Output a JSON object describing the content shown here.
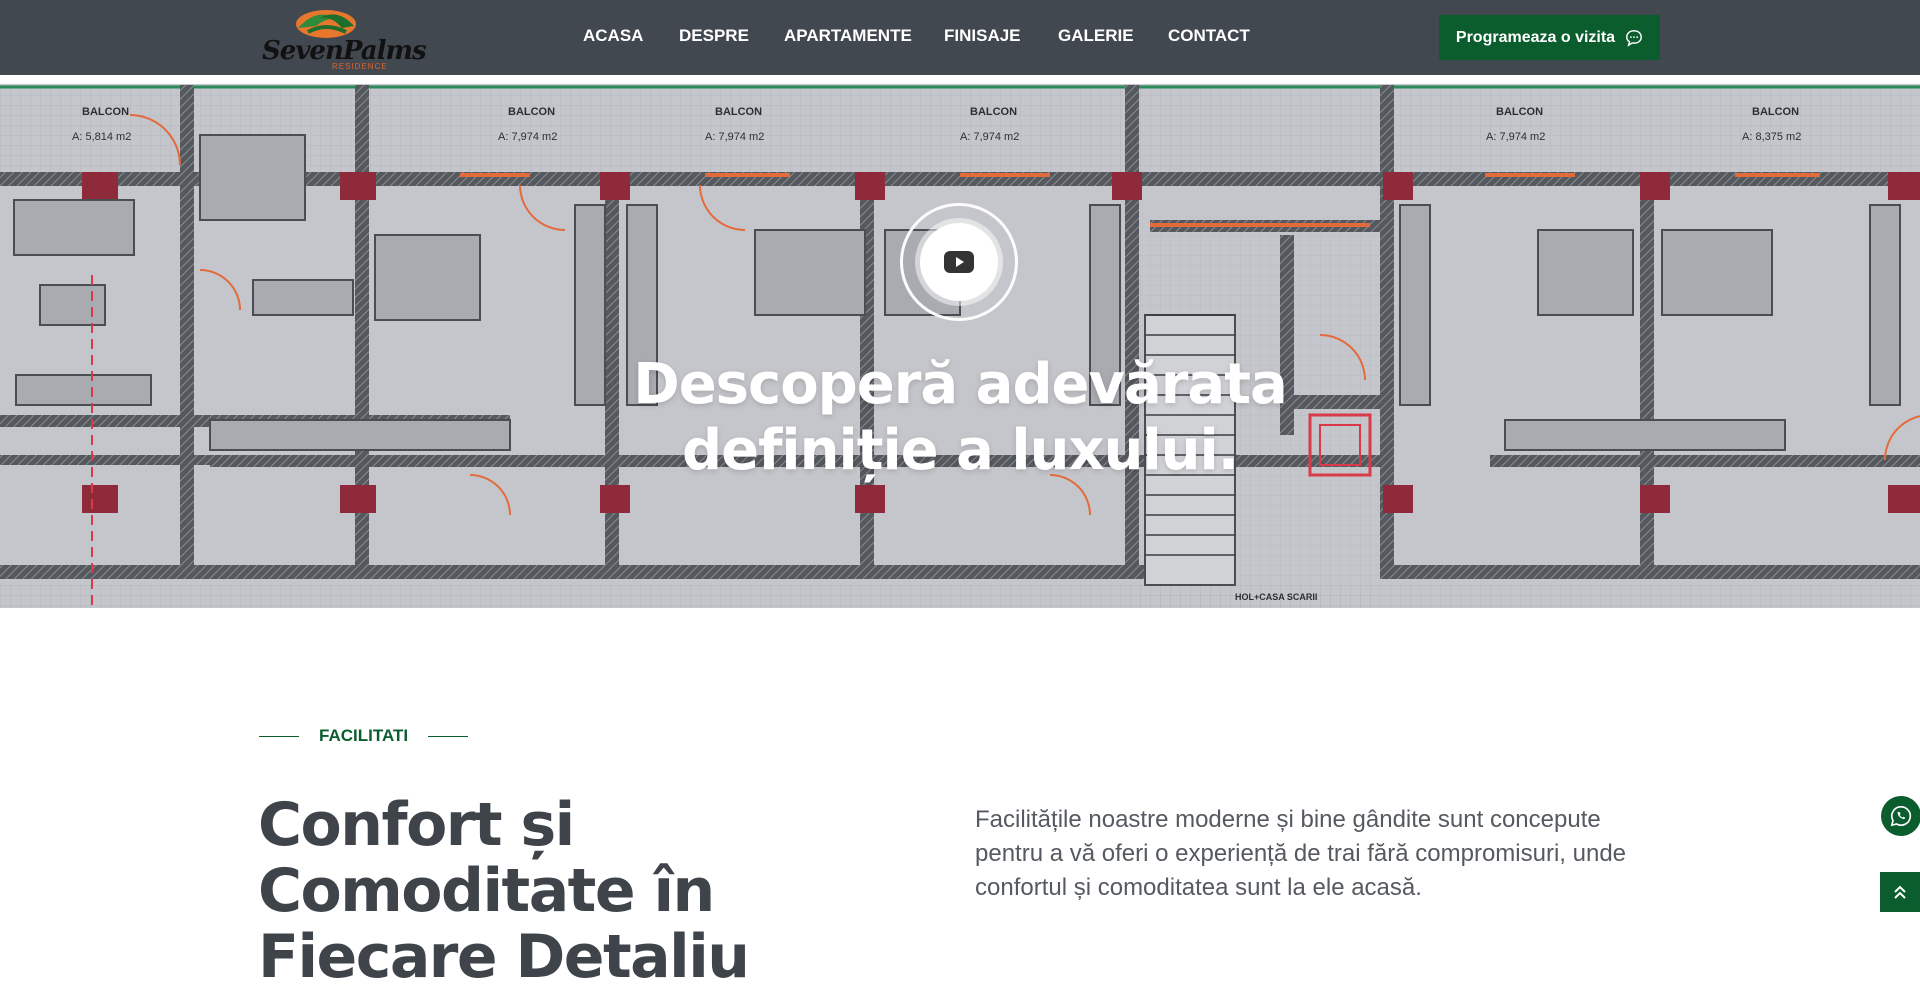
{
  "brand": {
    "name": "SevenPalms",
    "subtitle": "RESIDENCE"
  },
  "nav": [
    {
      "label": "ACASA"
    },
    {
      "label": "DESPRE"
    },
    {
      "label": "APARTAMENTE"
    },
    {
      "label": "FINISAJE"
    },
    {
      "label": "GALERIE"
    },
    {
      "label": "CONTACT"
    }
  ],
  "cta": {
    "label": "Programeaza o vizita",
    "icon": "chat-icon"
  },
  "hero": {
    "title": "Descoperă adevărata definiție a luxului.",
    "play_icon": "youtube-play-icon",
    "plan_labels": {
      "balcon": "BALCON",
      "areas": [
        "A: 5,814 m2",
        "A: 7,974 m2",
        "A: 7,974 m2",
        "A: 7,974 m2",
        "A: 7,974 m2",
        "A: 8,375 m2"
      ],
      "stair": "HOL+CASA SCARII"
    }
  },
  "facilities": {
    "eyebrow": "FACILITATI",
    "title": "Confort și Comoditate în Fiecare Detaliu",
    "description": "Facilitățile noastre moderne și bine gândite sunt concepute pentru a vă oferi o experiență de trai fără compromisuri, unde confortul și comoditatea sunt la ele acasă."
  },
  "floating": {
    "whatsapp_icon": "whatsapp-icon",
    "top_icon": "double-chevron-up-icon"
  },
  "colors": {
    "header": "#424850",
    "accent": "#0b5d2e",
    "plan_bg": "#c9cbd0"
  }
}
